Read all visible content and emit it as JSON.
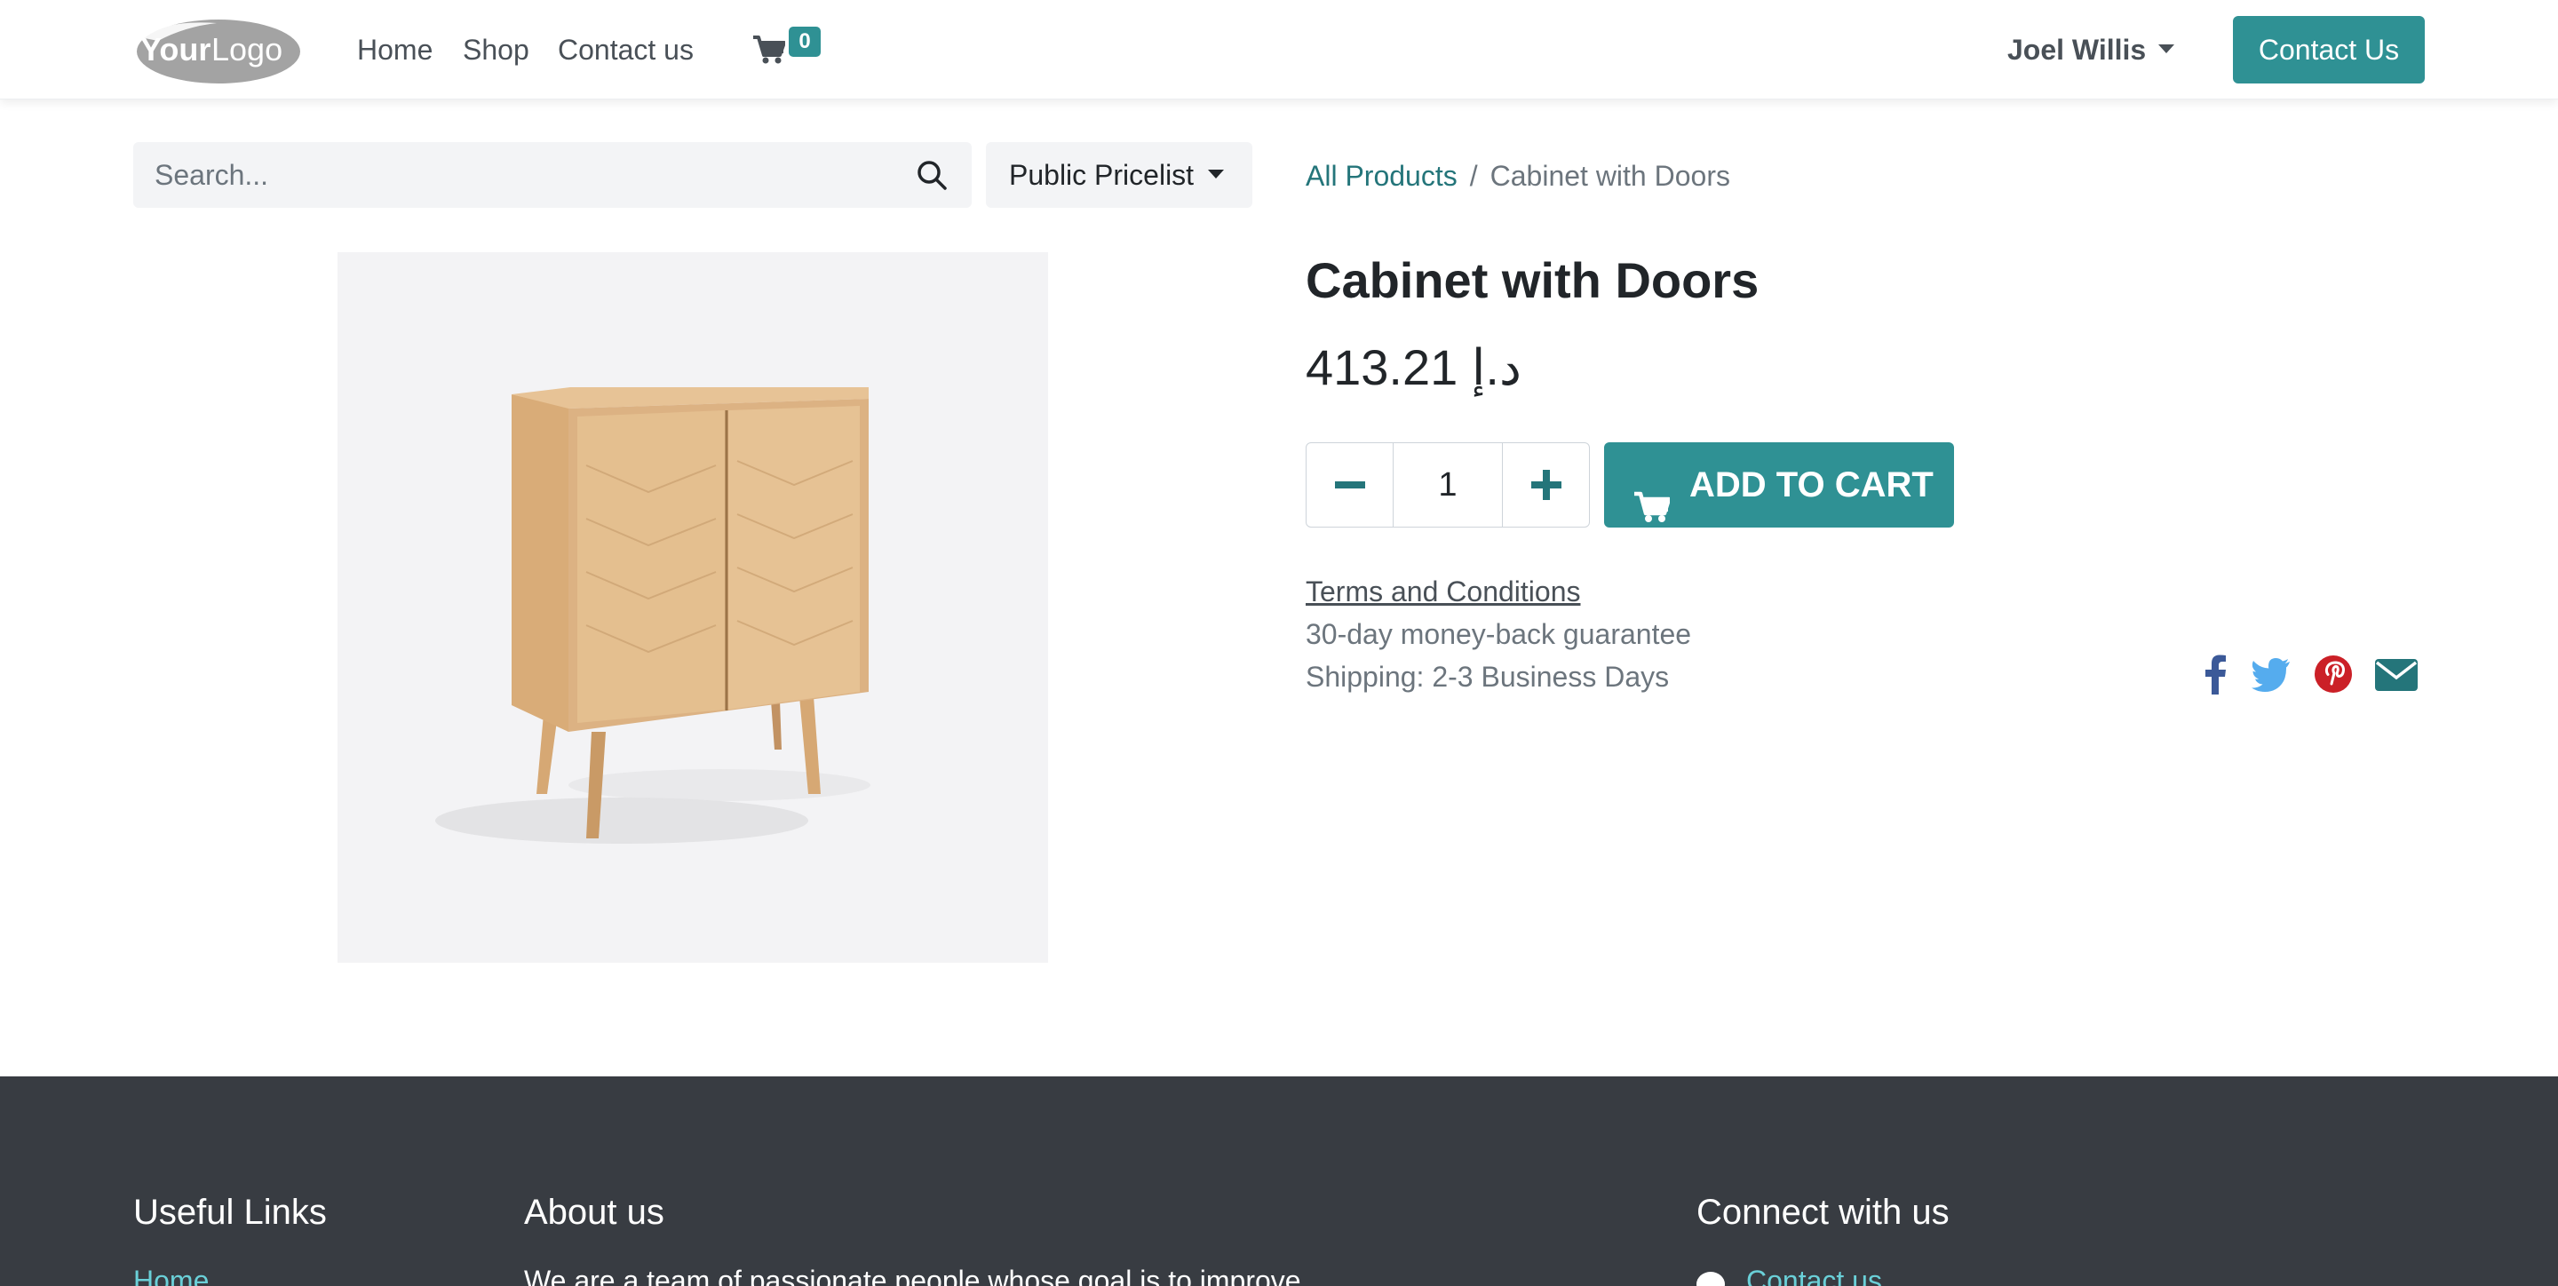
{
  "header": {
    "logo_text": "YourLogo",
    "nav": [
      {
        "label": "Home"
      },
      {
        "label": "Shop"
      },
      {
        "label": "Contact us"
      }
    ],
    "cart_count": "0",
    "user_name": "Joel Willis",
    "contact_button": "Contact Us"
  },
  "search": {
    "placeholder": "Search...",
    "value": ""
  },
  "pricelist": {
    "selected": "Public Pricelist"
  },
  "breadcrumb": {
    "parent": "All Products",
    "separator": "/",
    "current": "Cabinet with Doors"
  },
  "product": {
    "name": "Cabinet with Doors",
    "price": "413.21 د.إ",
    "quantity": "1",
    "add_to_cart_label": "ADD TO CART",
    "terms_label": "Terms and Conditions",
    "guarantee": "30-day money-back guarantee",
    "shipping": "Shipping: 2-3 Business Days"
  },
  "share": {
    "icons": [
      "facebook-icon",
      "twitter-icon",
      "pinterest-icon",
      "envelope-icon"
    ],
    "colors": {
      "facebook": "#3b5998",
      "twitter": "#55acee",
      "pinterest": "#cb2027",
      "email": "#24757a"
    }
  },
  "footer": {
    "useful_links_heading": "Useful Links",
    "useful_links_first": "Home",
    "about_heading": "About us",
    "about_text": "We are a team of passionate people whose goal is to improve",
    "connect_heading": "Connect with us",
    "connect_first": "Contact us"
  },
  "colors": {
    "primary": "#2f9194",
    "link": "#24757a",
    "footer_bg": "#383c42",
    "footer_link": "#6ad0d8"
  }
}
